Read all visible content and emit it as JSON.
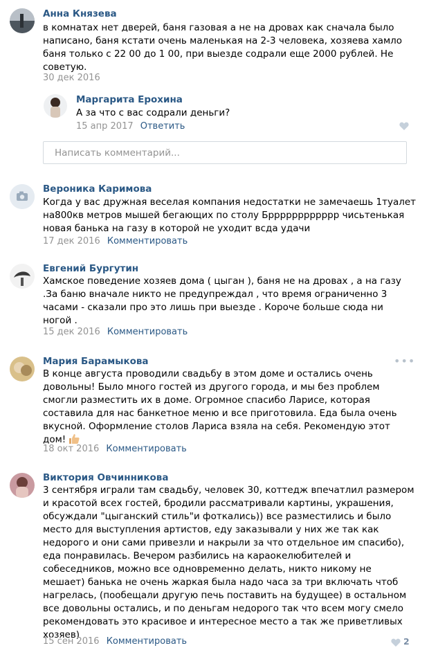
{
  "comments": [
    {
      "author": "Анна Князева",
      "lines": [
        "в комнатах нет дверей, баня газовая а не на дровах как сначала было",
        "написано, баня кстати очень маленькая на 2-3 человека, хозяева хамло",
        "баня только с 22 00 до 1 00, при выезде содрали еще 2000 рублей. Не",
        "советую."
      ],
      "date": "30 дек 2016",
      "reply": {
        "author": "Маргарита Ерохина",
        "text": "А за что с вас содрали деньги?",
        "date": "15 апр 2017",
        "action": "Ответить"
      }
    },
    {
      "author": "Вероника Каримова",
      "lines": [
        "Когда у вас дружная веселая компания недостатки не замечаешь 1туалет",
        "на800кв метров мышей бегающих по столу Брррррррррррр чисьтенькая",
        "новая банька на газу в которой не уходит всда удачи"
      ],
      "date": "17 дек 2016",
      "action": "Комментировать"
    },
    {
      "author": "Евгений Бургутин",
      "lines": [
        "Хамское поведение хозяев дома ( цыган ), баня не на дровах , а на газу",
        ".За баню вначале никто не предупреждал , что время ограниченно 3",
        "часами - сказали про это лишь при выезде . Короче больше сюда ни",
        "ногой ."
      ],
      "date": "15 дек 2016",
      "action": "Комментировать"
    },
    {
      "author": "Мария Барамыкова",
      "lines": [
        "В конце августа проводили свадьбу в этом доме и остались очень",
        "довольны! Было много гостей из другого города, и мы без проблем",
        "смогли разместить их в доме. Огромное спасибо Ларисе, которая",
        "составила для нас банкетное меню и все приготовила. Еда была очень",
        "вкусной. Оформление столов Лариса взяла на себя. Рекомендую этот",
        "дом!"
      ],
      "date": "18 окт 2016",
      "action": "Комментировать",
      "menu": "•••"
    },
    {
      "author": "Виктория Овчинникова",
      "lines": [
        "3 сентября играли там свадьбу, человек 30, коттедж впечатлил размером",
        "и красотой всех гостей, бродили рассматривали картины, украшения,",
        "обсуждали \"цыганский стиль\"и фоткались)) все разместились и было",
        "место для выступления артистов, еду заказывали у них же так как",
        "недорого и они сами привезли и накрыли за что отдельное им спасибо),",
        "еда понравилась. Вечером разбились на караоке­любителей и",
        "собеседников, можно все одновременно делать, никто никому не",
        "мешает) банька не очень жаркая была надо часа за три включать чтоб",
        "нагрелась, (пообещали другую печь поставить на будущее) в остальном",
        "все довольны остались, и по деньгам недорого так что всем могу смело",
        "рекомендовать это красивое и интересное место а так же приветливых",
        "хозяев)"
      ],
      "date": "15 сен 2016",
      "action": "Комментировать",
      "likes": "2"
    }
  ],
  "input": {
    "placeholder": "Написать комментарий..."
  },
  "colors": {
    "link": "#2a5885",
    "muted": "#939393",
    "border": "#d3d9de"
  }
}
